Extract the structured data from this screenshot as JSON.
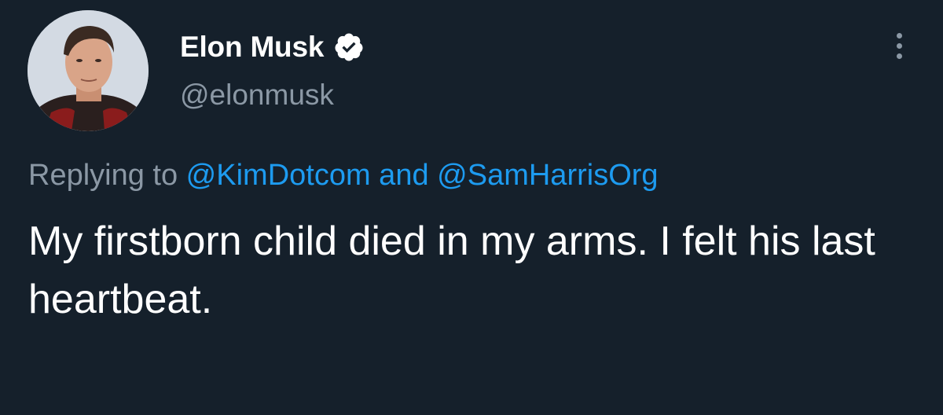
{
  "tweet": {
    "author": {
      "name": "Elon Musk",
      "handle": "@elonmusk",
      "verified_icon": "verified-badge-icon",
      "avatar_icon": "profile-avatar"
    },
    "more_icon": "more-options-icon",
    "reply_context": {
      "prefix": "Replying to ",
      "mention1": "@KimDotcom",
      "conjunction": " and ",
      "mention2": "@SamHarrisOrg"
    },
    "text": "My firstborn child died in my arms. I felt his last heartbeat."
  },
  "colors": {
    "background": "#15202b",
    "primary_text": "#ffffff",
    "secondary_text": "#8b98a5",
    "link": "#1d9bf0"
  }
}
